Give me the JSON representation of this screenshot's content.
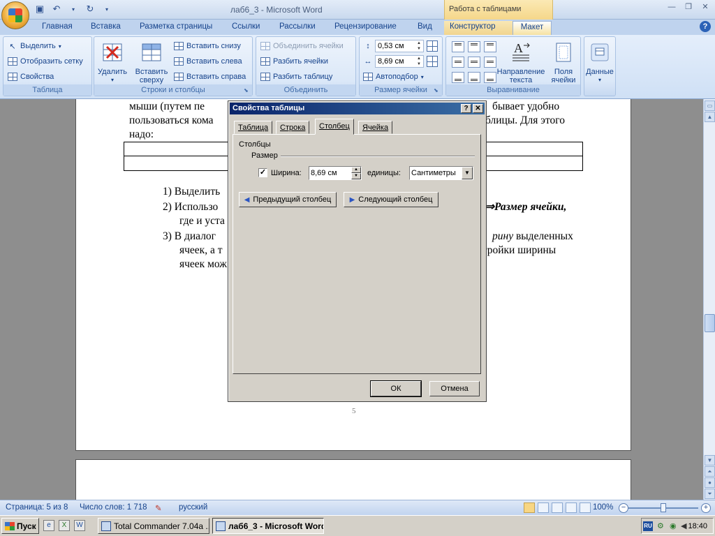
{
  "window": {
    "title": "лаб6_3 - Microsoft Word",
    "contextual_title": "Работа с таблицами",
    "min": "—",
    "max": "❐",
    "close": "✕"
  },
  "tabs": [
    "Главная",
    "Вставка",
    "Разметка страницы",
    "Ссылки",
    "Рассылки",
    "Рецензирование",
    "Вид",
    "Конструктор",
    "Макет"
  ],
  "ribbon": {
    "table_group": {
      "label": "Таблица",
      "select": "Выделить",
      "show_grid": "Отобразить сетку",
      "properties": "Свойства"
    },
    "rows_cols_group": {
      "label": "Строки и столбцы",
      "delete": "Удалить",
      "insert_above_1": "Вставить",
      "insert_above_2": "сверху",
      "insert_below": "Вставить снизу",
      "insert_left": "Вставить слева",
      "insert_right": "Вставить справа"
    },
    "merge_group": {
      "label": "Объединить",
      "merge_cells": "Объединить ячейки",
      "split_cells": "Разбить ячейки",
      "split_table": "Разбить таблицу"
    },
    "cell_size_group": {
      "label": "Размер ячейки",
      "height": "0,53 см",
      "width": "8,69 см",
      "autofit": "Автоподбор"
    },
    "alignment_group": {
      "label": "Выравнивание",
      "direction_1": "Направление",
      "direction_2": "текста",
      "margins_1": "Поля",
      "margins_2": "ячейки"
    },
    "data": "Данные"
  },
  "document": {
    "line1_a": "мыши (путем пе",
    "line1_b": "бывает удобно",
    "line2_a": "пользоваться кома",
    "line2_b": "блицы. Для этого",
    "line3": "надо:",
    "item1": "1)  Выделить",
    "item2_a": "2)  Использо",
    "item2_b": "⇒Размер ячейки,",
    "item2_c": "где и уста",
    "item3_a": "3)  В диалог",
    "item3_b_italic": "рину",
    "item3_b": " выделенных",
    "item3_c": "ячеек, а т",
    "item3_d": "астройки ширины",
    "item3_e": "ячеек мож",
    "page_number": "5"
  },
  "dialog": {
    "title": "Свойства таблицы",
    "help": "?",
    "close": "✕",
    "tabs": [
      "Таблица",
      "Строка",
      "Столбец",
      "Ячейка"
    ],
    "section": "Столбцы",
    "subsection": "Размер",
    "width_checkbox": "✓",
    "width_label": "Ширина:",
    "width_value": "8,69 см",
    "units_label": "единицы:",
    "units_value": "Сантиметры",
    "prev_column": "Предыдущий столбец",
    "next_column": "Следующий столбец",
    "ok": "ОК",
    "cancel": "Отмена"
  },
  "statusbar": {
    "page": "Страница: 5 из 8",
    "words": "Число слов: 1 718",
    "language": "русский",
    "zoom": "100%"
  },
  "taskbar": {
    "start": "Пуск",
    "task1": "Total Commander 7.04a ...",
    "task2": "лаб6_3 - Microsoft Word",
    "lang": "RU",
    "clock": "18:40"
  }
}
